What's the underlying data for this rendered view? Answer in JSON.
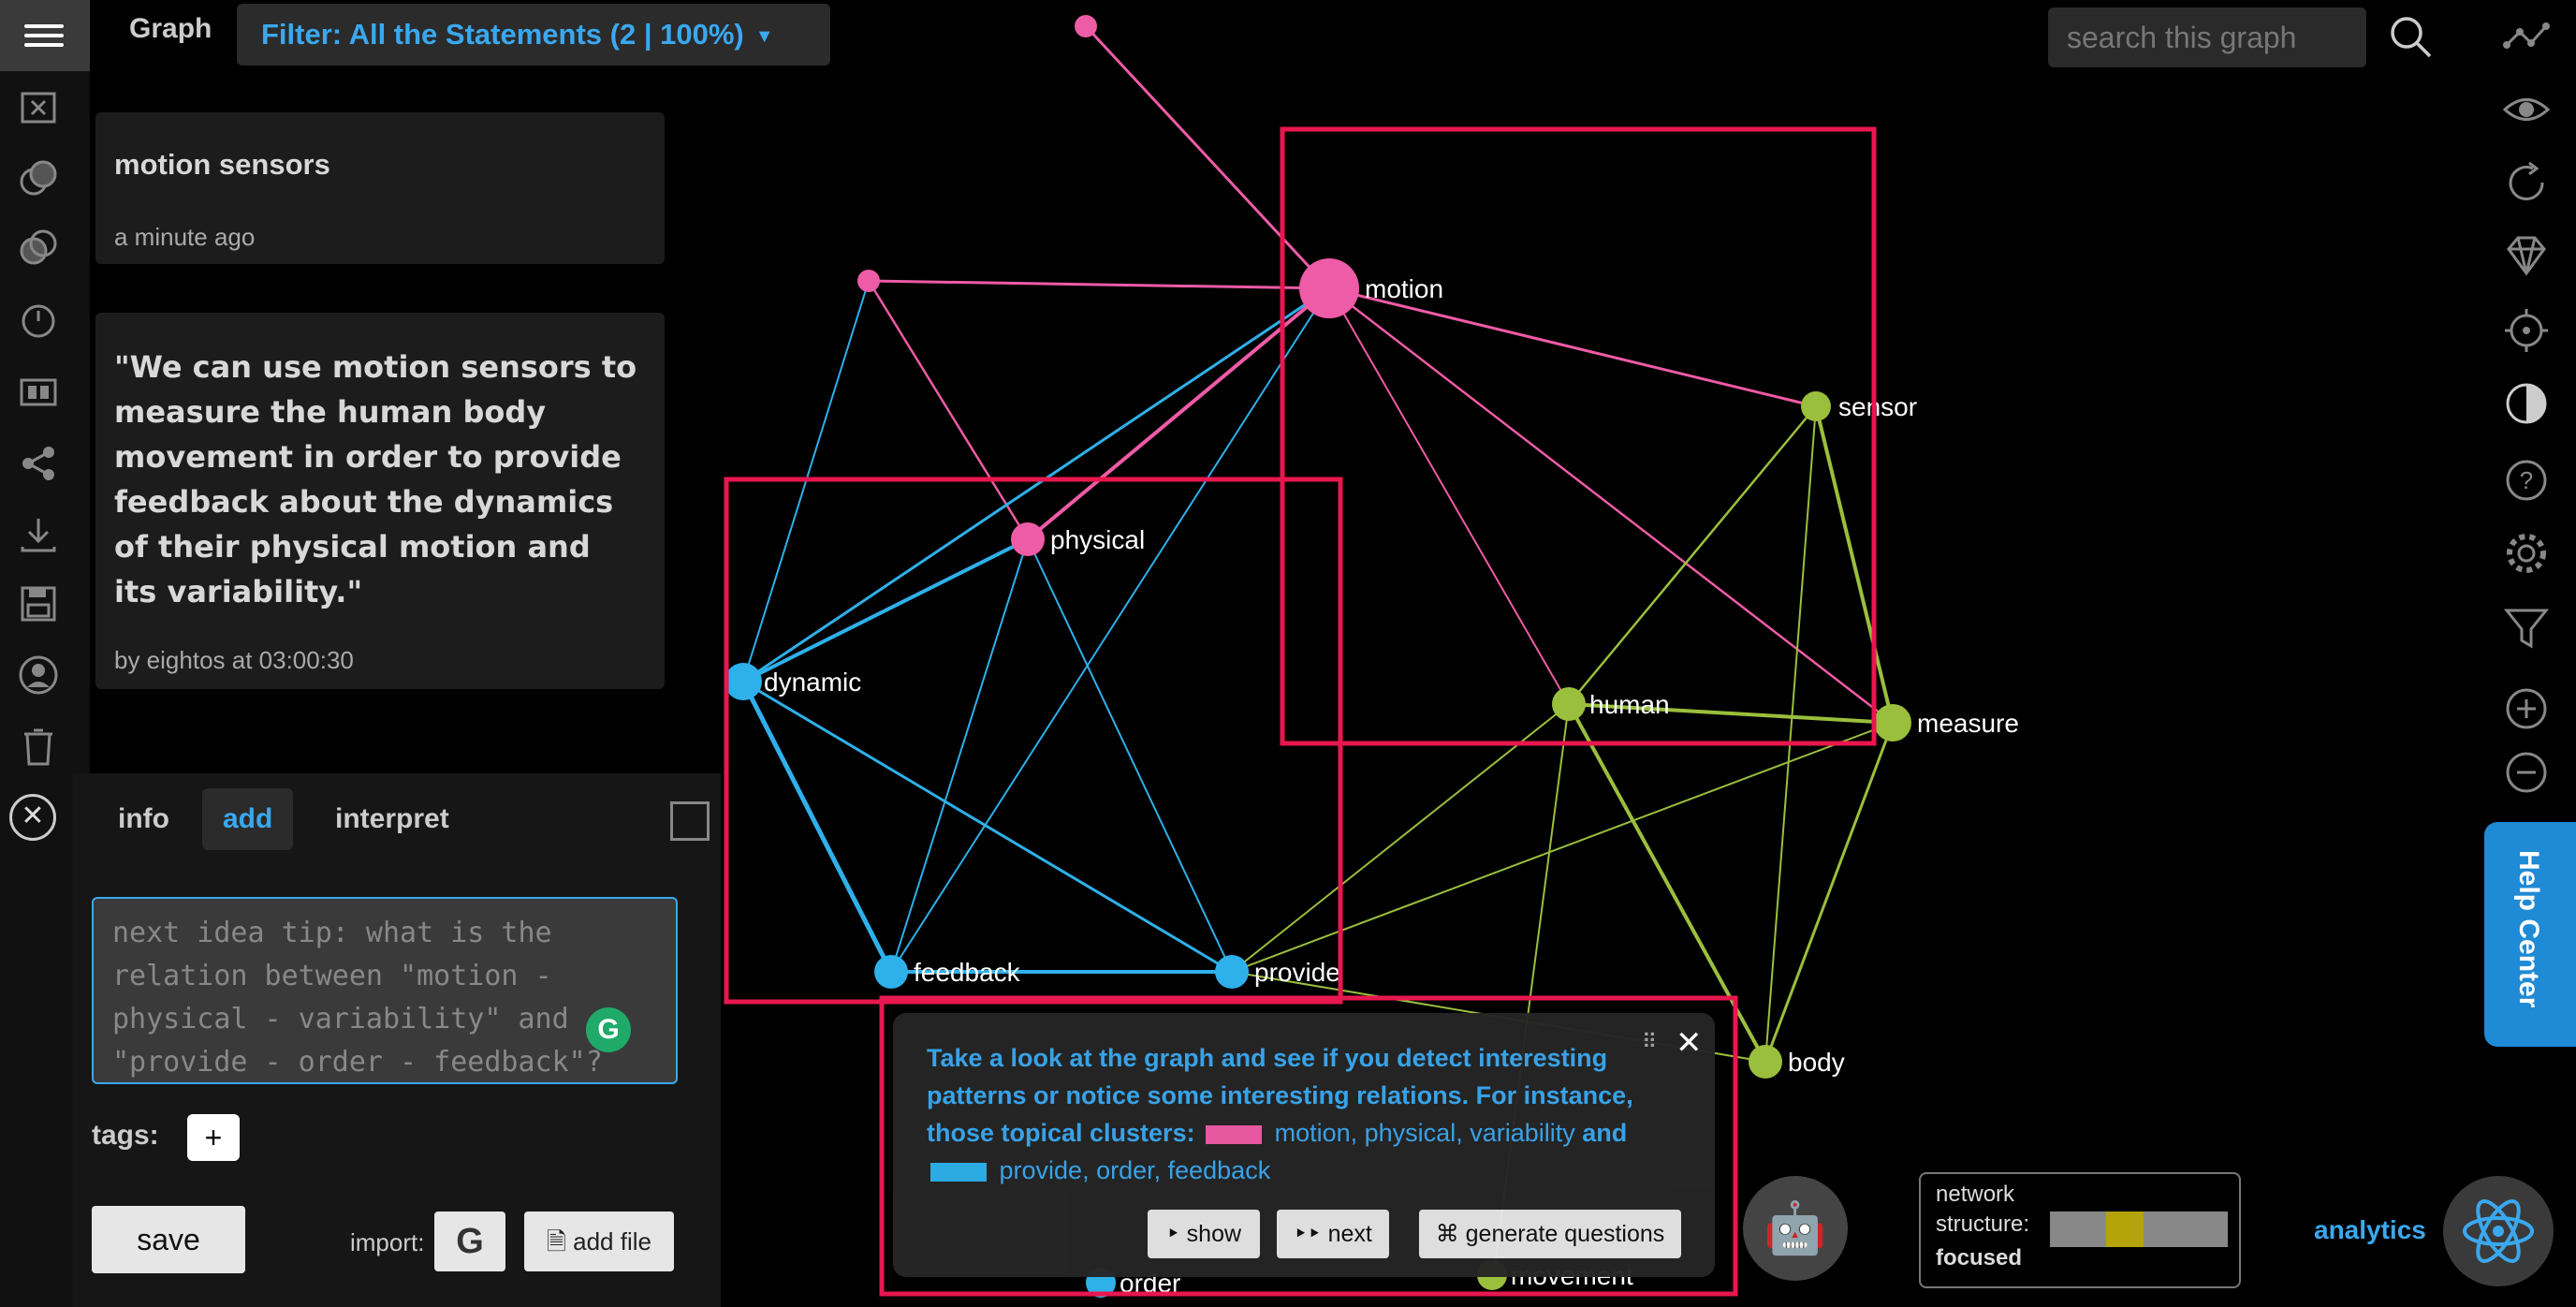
{
  "header": {
    "title": "Graph",
    "filter_label": "Filter: All the Statements (2 | 100%)"
  },
  "search": {
    "placeholder": "search this graph"
  },
  "statement_card": {
    "title": "motion sensors",
    "time": "a minute ago"
  },
  "quote_card": {
    "text": "\"We can use motion sensors to measure the human body movement in order to provide feedback about the dynamics of their physical motion and its variability.\"",
    "byline": "by eightos at 03:00:30"
  },
  "add_panel": {
    "tabs": [
      "info",
      "add",
      "interpret"
    ],
    "active_tab": "add",
    "input_placeholder": "next idea tip: what is the relation between \"motion - physical - variability\" and \"provide - order - feedback\"?",
    "tags_label": "tags:",
    "tags_add": "+",
    "save_label": "save",
    "import_label": "import:",
    "google_label": "G",
    "add_file_label": "add file"
  },
  "graph": {
    "nodes": [
      {
        "id": "motion",
        "label": "motion",
        "color": "#ee5ba6"
      },
      {
        "id": "physical",
        "label": "physical",
        "color": "#ee5ba6"
      },
      {
        "id": "sensor",
        "label": "sensor",
        "color": "#9abf3c"
      },
      {
        "id": "human",
        "label": "human",
        "color": "#9abf3c"
      },
      {
        "id": "measure",
        "label": "measure",
        "color": "#9abf3c"
      },
      {
        "id": "dynamic",
        "label": "dynamic",
        "color": "#2eb0ea"
      },
      {
        "id": "feedback",
        "label": "feedback",
        "color": "#2eb0ea"
      },
      {
        "id": "provide",
        "label": "provide",
        "color": "#2eb0ea"
      },
      {
        "id": "body",
        "label": "body",
        "color": "#9abf3c"
      },
      {
        "id": "order",
        "label": "order",
        "color": "#2eb0ea"
      },
      {
        "id": "movement",
        "label": "movement",
        "color": "#9abf3c"
      }
    ]
  },
  "popup": {
    "line1": "Take a look at the graph and see if you detect interesting patterns or notice some interesting relations.",
    "line2_prefix": "For instance, those topical clusters:",
    "cluster1": "motion, physical, variability",
    "and": "and",
    "cluster2": "provide, order, feedback",
    "cluster1_color": "#ee5ba6",
    "cluster2_color": "#2eb0ea",
    "show_label": "‣ show",
    "next_label": "‣‣ next",
    "generate_label": "⌘ generate questions"
  },
  "network": {
    "label_line1": "network",
    "label_line2": "structure:",
    "state": "focused",
    "focus_position": 0.42
  },
  "analytics_label": "analytics",
  "help_center_label": "Help Center",
  "colors": {
    "accent": "#3aa8ef",
    "highlight_box": "#e8174f"
  }
}
